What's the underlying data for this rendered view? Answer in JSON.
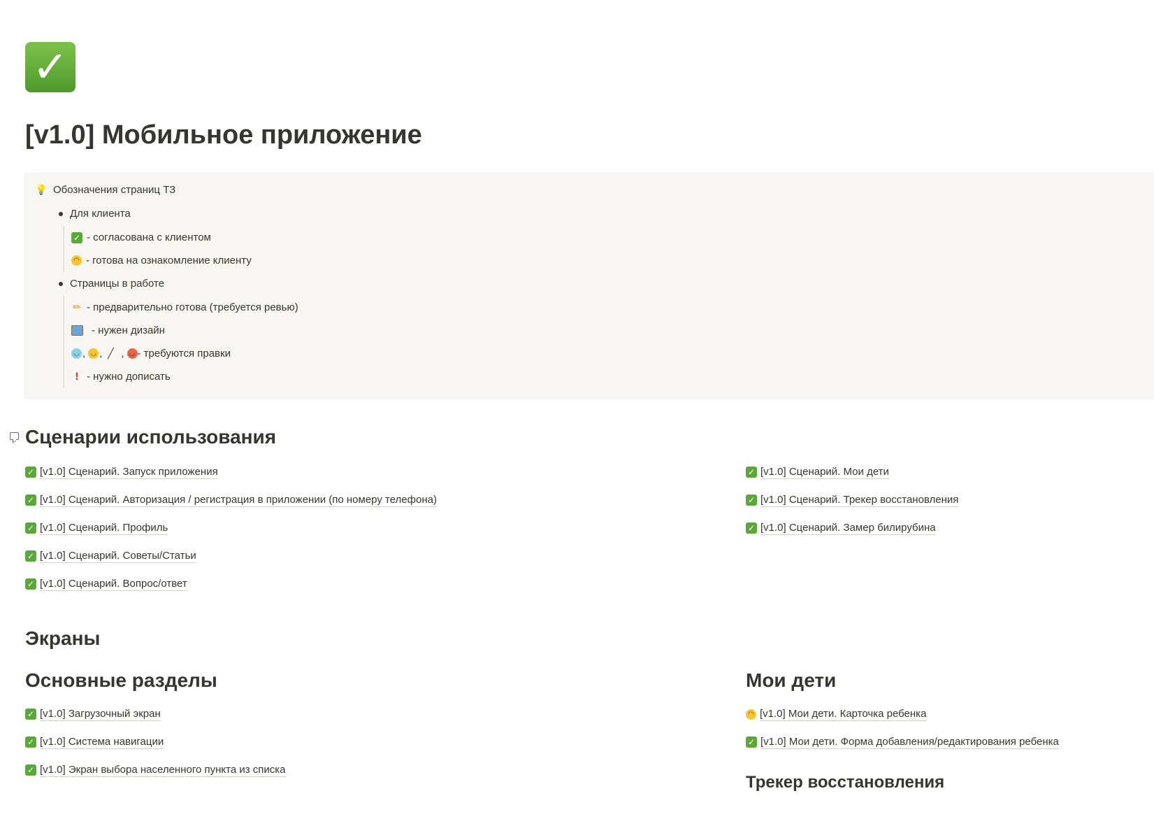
{
  "page": {
    "icon": "check-mark-button-icon",
    "title": "[v1.0] Мобильное приложение"
  },
  "callout": {
    "icon": "light-bulb-icon",
    "title": "Обозначения страниц ТЗ",
    "groups": [
      {
        "label": "Для клиента",
        "items": [
          {
            "icon": "check-mark-icon",
            "text": "- согласована с клиентом"
          },
          {
            "icon": "upside-down-face-icon",
            "text": "- готова на ознакомление клиенту"
          }
        ]
      },
      {
        "label": "Страницы в работе",
        "items": [
          {
            "icon": "pencil-icon",
            "text": "- предварительно готова (требуется ревью)"
          },
          {
            "icon": "framed-picture-icon",
            "text": "- нужен дизайн"
          },
          {
            "icon": "multi-emoji-icon",
            "text": "- требуются правки",
            "prefix": ", , , "
          },
          {
            "icon": "exclamation-icon",
            "text": "- нужно дописать"
          }
        ]
      }
    ]
  },
  "scenarios": {
    "heading": "Сценарии использования",
    "left": [
      {
        "icon": "check-mark-icon",
        "text": "[v1.0] Сценарий. Запуск приложения"
      },
      {
        "icon": "check-mark-icon",
        "text": "[v1.0] Сценарий. Авторизация / регистрация в приложении (по номеру телефона)"
      },
      {
        "icon": "check-mark-icon",
        "text": "[v1.0] Сценарий. Профиль"
      },
      {
        "icon": "check-mark-icon",
        "text": "[v1.0] Сценарий. Советы/Статьи"
      },
      {
        "icon": "check-mark-icon",
        "text": "[v1.0] Сценарий. Вопрос/ответ"
      }
    ],
    "right": [
      {
        "icon": "check-mark-icon",
        "text": "[v1.0] Сценарий. Мои дети"
      },
      {
        "icon": "check-mark-icon",
        "text": "[v1.0] Сценарий. Трекер восстановления"
      },
      {
        "icon": "check-mark-icon",
        "text": "[v1.0] Сценарий. Замер билирубина"
      }
    ]
  },
  "screens": {
    "heading": "Экраны",
    "main": {
      "heading": "Основные разделы",
      "items": [
        {
          "icon": "check-mark-icon",
          "text": "[v1.0] Загрузочный экран"
        },
        {
          "icon": "check-mark-icon",
          "text": "[v1.0] Система навигации"
        },
        {
          "icon": "check-mark-icon",
          "text": "[v1.0] Экран выбора населенного пункта из списка"
        }
      ]
    },
    "kids": {
      "heading": "Мои дети",
      "items": [
        {
          "icon": "upside-down-face-icon",
          "text": "[v1.0] Мои дети. Карточка ребенка"
        },
        {
          "icon": "check-mark-icon",
          "text": "[v1.0] Мои дети. Форма добавления/редактирования ребенка"
        }
      ]
    },
    "tracker": {
      "heading": "Трекер восстановления"
    }
  }
}
